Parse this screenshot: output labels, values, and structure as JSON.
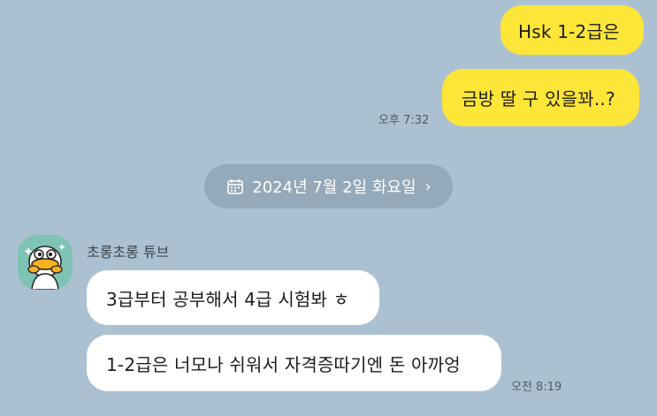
{
  "messages": {
    "sent": [
      {
        "text": "Hsk 1-2급은"
      },
      {
        "text": "금방 딸 구 있을꽈..?",
        "time": "오후 7:32"
      }
    ],
    "date_divider": {
      "text": "2024년 7월 2일 화요일",
      "chevron": "›"
    },
    "received": {
      "sender": "초롱초롱 튜브",
      "items": [
        {
          "text": "3급부터 공부해서 4급 시험봐 ㅎ"
        },
        {
          "text": "1-2급은 너모나 쉬워서 자격증따기엔 돈 아까엉",
          "time": "오전 8:19"
        }
      ]
    }
  },
  "colors": {
    "background": "#abc1d1",
    "sent_bubble": "#fde637",
    "received_bubble": "#ffffff"
  },
  "icons": {
    "calendar": "calendar-icon",
    "chevron": "chevron-right-icon",
    "avatar": "duck-avatar"
  }
}
